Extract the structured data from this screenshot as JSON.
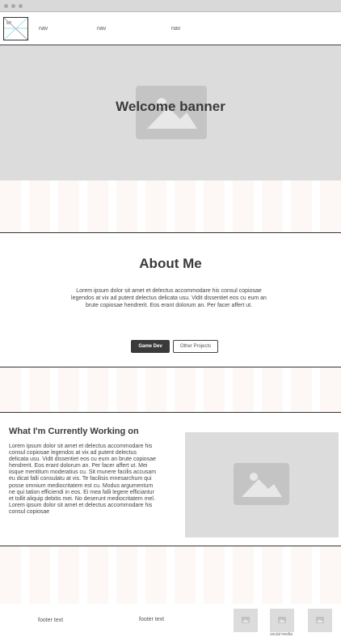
{
  "nav": {
    "items": [
      {
        "label": "nav"
      },
      {
        "label": "nav"
      },
      {
        "label": "nav"
      }
    ]
  },
  "banner": {
    "title": "Welcome banner",
    "icon": "image-icon"
  },
  "about": {
    "title": "About Me",
    "text": "Lorem ipsum dolor sit amet et delectus accommodare his consul copiosae legendos at vix ad putent delectus delicata usu. Vidit dissentiet eos cu eum an brute copiosae hendrerit. Eos erant dolorum an. Per facer affert ut.",
    "buttons": {
      "game_dev": "Game Dev",
      "other_projects": "Other Projects"
    }
  },
  "current_work": {
    "title": "What I'm Currently Working on",
    "text": "Lorem ipsum dolor sit amet et delectus accommodare his consul copiosae legendos at vix ad putent delectus delicata usu. Vidit dissentiet eos cu eum an brute copiosae hendrerit. Eos erant dolorum an. Per facer affert ut. Mei iisque mentitum moderatius cu. Sit munere facilis accusam eu dicat falli consulatu at vis. Te facilisis mnesarchum qui posse omnium mediocritatem est cu. Modus argumentum ne qui tation efficiendi in eos. Ei mea falli legere efficiantur et tollit aliquip debitis mei. No deserunt mediocritatem mel. Lorem ipsum dolor sit amet et delectus accommodare his consul copiosae",
    "icon": "image-icon"
  },
  "footer": {
    "text_left": "footer text",
    "text_center": "footer text",
    "social_label": "social media",
    "icons": [
      "image-icon",
      "image-icon",
      "image-icon"
    ]
  },
  "colors": {
    "placeholder": "#dcdcdc",
    "placeholder_icon": "#c4c4c4",
    "stripe": "#fdf8f6",
    "dark_button": "#3a3a3a",
    "divider": "#333333"
  }
}
